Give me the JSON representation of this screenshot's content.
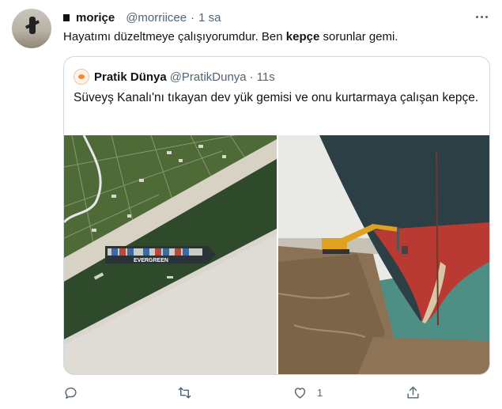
{
  "tweet": {
    "name": "moriçe",
    "handle": "@morriicee",
    "separator": "·",
    "time": "1 sa",
    "text_before": "Hayatımı düzeltmeye çalışıyorumdur. Ben ",
    "text_bold": "kepçe",
    "text_after": " sorunlar gemi."
  },
  "quote": {
    "name": "Pratik Dünya",
    "handle": "@PratikDunya",
    "separator": "·",
    "time": "11s",
    "text": "Süveyş Kanalı'nı tıkayan dev yük gemisi ve onu kurtarmaya çalışan kepçe.",
    "ship_label": "EVERGREEN"
  },
  "actions": {
    "reply_count": "",
    "retweet_count": "",
    "like_count": "1"
  },
  "colors": {
    "text": "#0f1419",
    "secondary": "#536471",
    "border": "#cfd9de",
    "canal_water": "#2f4a2a",
    "hull_red": "#b83a33",
    "hull_dark": "#2c3f44"
  }
}
